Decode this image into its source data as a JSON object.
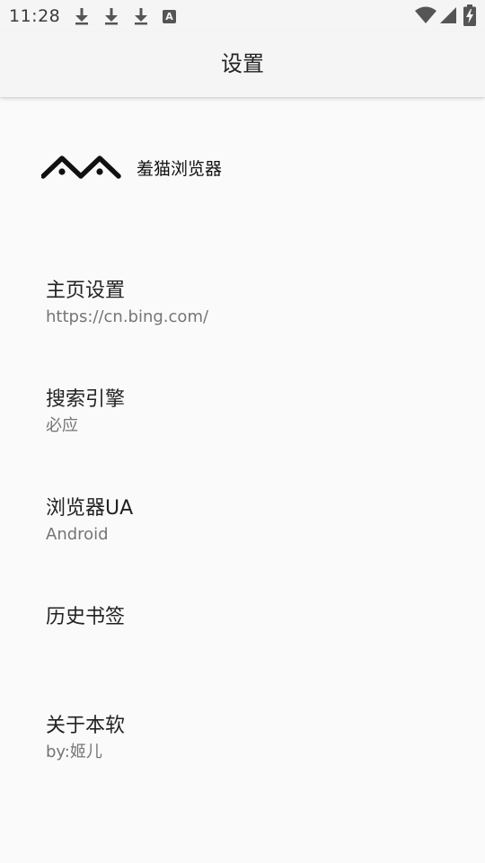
{
  "status_bar": {
    "time": "11:28",
    "notification_icons": [
      "download-icon",
      "download-icon",
      "download-icon",
      "text-a-icon"
    ],
    "notification_letter": "A",
    "system_icons": [
      "wifi-icon",
      "cellular-signal-icon",
      "battery-charging-icon"
    ]
  },
  "app_bar": {
    "title": "设置"
  },
  "brand": {
    "logo_icon": "cat-logo-icon",
    "name": "羞猫浏览器"
  },
  "settings": [
    {
      "title": "主页设置",
      "summary": "https://cn.bing.com/"
    },
    {
      "title": "搜索引擎",
      "summary": "必应"
    },
    {
      "title": "浏览器UA",
      "summary": "Android"
    },
    {
      "title": "历史书签",
      "summary": ""
    },
    {
      "title": "关于本软",
      "summary": "by:姬儿"
    }
  ],
  "colors": {
    "background": "#fafafa",
    "app_bar": "#f5f5f5",
    "title_text": "#222222",
    "summary_text": "#757575"
  }
}
